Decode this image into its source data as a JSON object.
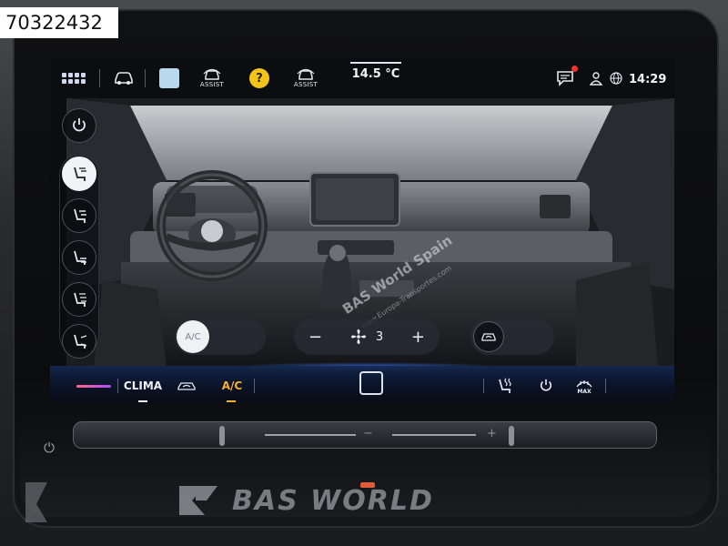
{
  "listing_id": "70322432",
  "topbar": {
    "assist_label_1": "ASSIST",
    "assist_label_2": "ASSIST",
    "help_glyph": "?",
    "outside_temp": "14.5 °C",
    "clock": "14:29",
    "icons": [
      "app-grid-icon",
      "vehicle-icon",
      "light-square-icon",
      "driver-assist-icon",
      "help-icon",
      "driver-assist-icon",
      "message-icon",
      "user-icon",
      "globe-icon"
    ],
    "notification_color": "#e33333"
  },
  "climate": {
    "left_rail": [
      "power-icon",
      "seat-airflow-icon",
      "airflow-face-feet-icon",
      "airflow-feet-icon",
      "airflow-face-icon",
      "airflow-windshield-feet-icon"
    ],
    "active_rail_index": 1,
    "ac_toggle_label": "A/C",
    "fan_minus": "−",
    "fan_plus": "+",
    "fan_level": "3",
    "recirc_icon": "recirculation-icon"
  },
  "bottombar": {
    "clima_label": "CLIMA",
    "ac_label": "A/C",
    "ac_color": "#f3b32a",
    "defrost_label": "MAX",
    "icons": [
      "temperature-slider",
      "air-flow-icon",
      "home-button",
      "seat-heat-icon",
      "power-icon",
      "max-defrost-icon"
    ]
  },
  "hardware": {
    "volume_minus": "−",
    "volume_plus": "+",
    "power_glyph": "⏻"
  },
  "watermark": {
    "brand": "BAS WORLD",
    "overlay_main": "BAS World Spain",
    "overlay_sub": "www.Europa-Transportes.com"
  }
}
